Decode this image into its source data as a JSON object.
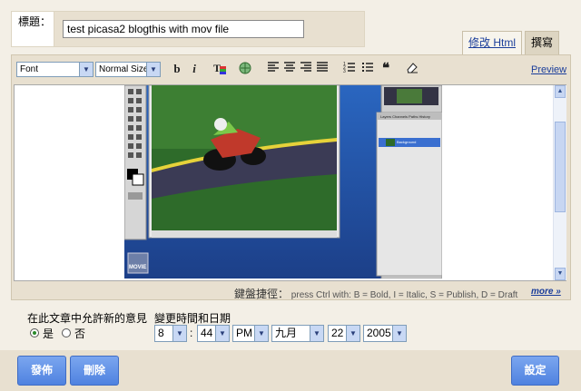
{
  "title": {
    "label": "標題：",
    "value": "test picasa2 blogthis with mov file"
  },
  "tabs": {
    "edit_html": "修改 Html",
    "compose": "撰寫"
  },
  "toolbar": {
    "font": "Font",
    "size": "Normal Size",
    "bold": "b",
    "italic": "i",
    "preview": "Preview"
  },
  "editor": {
    "image_label": "MOVIE",
    "ps_tabs": "Layers  Channels  Paths  History",
    "ps_layer": "Background"
  },
  "shortcuts": {
    "label": "鍵盤捷徑：",
    "text": "press Ctrl with: B = Bold, I = Italic, S = Publish, D = Draft",
    "more": "more »"
  },
  "comments": {
    "label": "在此文章中允許新的意見",
    "yes": "是",
    "no": "否",
    "selected": "yes"
  },
  "datetime": {
    "label": "變更時間和日期",
    "hour": "8",
    "minute": "44",
    "ampm": "PM",
    "month": "九月",
    "day": "22",
    "year": "2005"
  },
  "buttons": {
    "publish": "發佈",
    "delete": "刪除",
    "settings": "設定"
  },
  "colors": {
    "accent": "#4f82e0",
    "link": "#1a3d9a",
    "frame": "#e8e0d0"
  }
}
